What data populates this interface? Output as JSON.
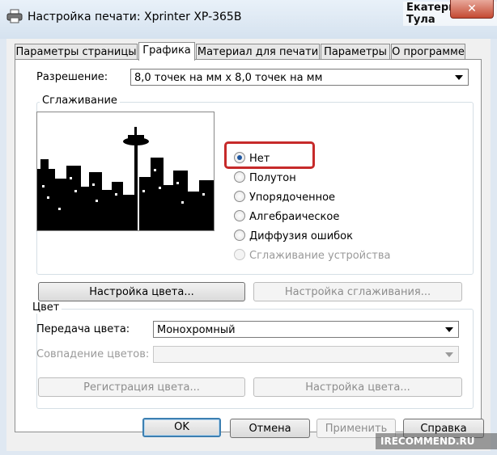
{
  "window": {
    "title": "Настройка печати: Xprinter XP-365B",
    "user_name": "Екатерина Тула",
    "close_symbol": "✕"
  },
  "tabs": [
    {
      "label": "Параметры страницы",
      "active": false
    },
    {
      "label": "Графика",
      "active": true
    },
    {
      "label": "Материал для печати",
      "active": false
    },
    {
      "label": "Параметры",
      "active": false
    },
    {
      "label": "О программе",
      "active": false
    }
  ],
  "resolution": {
    "label": "Разрешение:",
    "value": "8,0 точек на мм x 8,0 точек на мм"
  },
  "dithering": {
    "group_title": "Сглаживание",
    "options": [
      {
        "label": "Нет",
        "checked": true,
        "enabled": true
      },
      {
        "label": "Полутон",
        "checked": false,
        "enabled": true
      },
      {
        "label": "Упорядоченное",
        "checked": false,
        "enabled": true
      },
      {
        "label": "Алгебраическое",
        "checked": false,
        "enabled": true
      },
      {
        "label": "Диффузия ошибок",
        "checked": false,
        "enabled": true
      },
      {
        "label": "Сглаживание устройства",
        "checked": false,
        "enabled": false
      }
    ],
    "color_settings_button": "Настройка цвета...",
    "dither_settings_button": "Настройка сглаживания..."
  },
  "color": {
    "group_title": "Цвет",
    "transfer_label": "Передача цвета:",
    "transfer_value": "Монохромный",
    "match_label": "Совпадение цветов:",
    "match_value": "",
    "register_button": "Регистрация цвета...",
    "settings_button": "Настройка цвета..."
  },
  "footer": {
    "ok": "OK",
    "cancel": "Отмена",
    "apply": "Применить",
    "help": "Справка"
  },
  "watermark": "IRECOMMEND.RU",
  "colors": {
    "highlight": "#c62a2a",
    "radio_dot": "#1e56a0"
  }
}
